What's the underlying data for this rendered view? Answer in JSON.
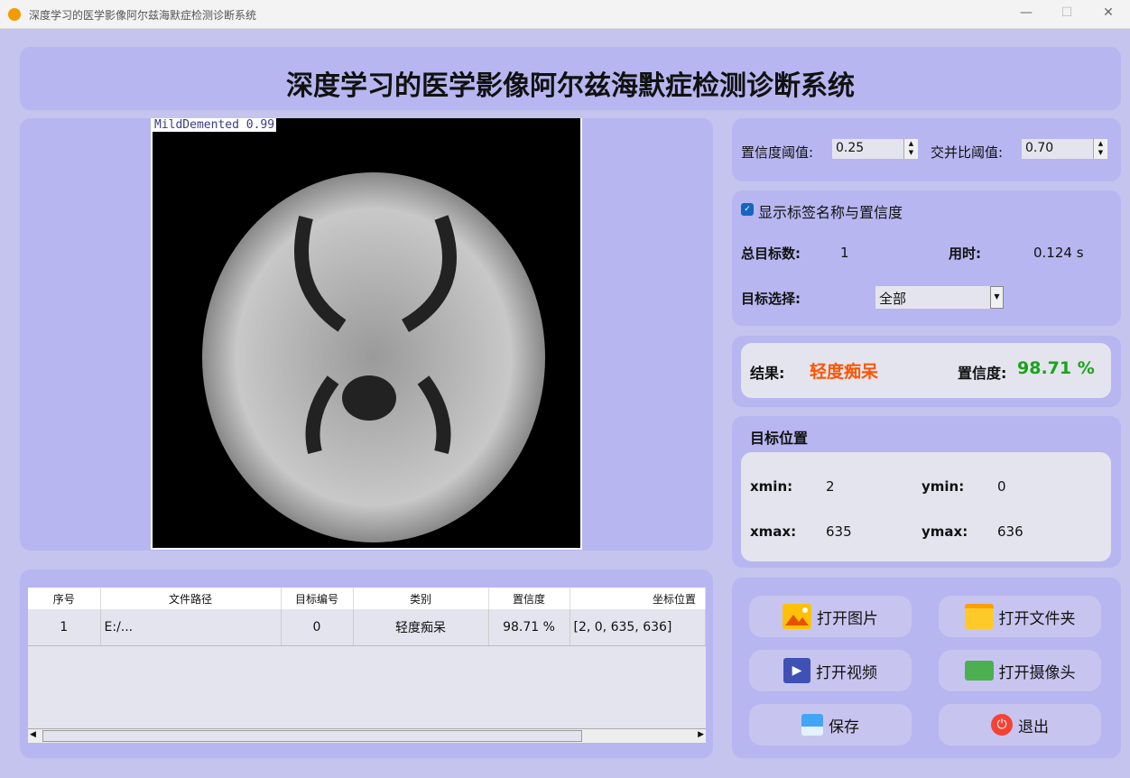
{
  "window": {
    "title": "深度学习的医学影像阿尔兹海默症检测诊断系统",
    "minimize": "—",
    "maximize": "☐",
    "close": "✕"
  },
  "header": {
    "title": "深度学习的医学影像阿尔兹海默症检测诊断系统"
  },
  "image": {
    "overlay_label": "MildDemented  0.99"
  },
  "settings": {
    "conf_label": "置信度阈值:",
    "conf_value": "0.25",
    "iou_label": "交并比阈值:",
    "iou_value": "0.70"
  },
  "stats": {
    "show_label": "显示标签名称与置信度",
    "show_checked": true,
    "total_label": "总目标数:",
    "total_value": "1",
    "time_label": "用时:",
    "time_value": "0.124 s",
    "select_label": "目标选择:",
    "select_value": "全部"
  },
  "result": {
    "label": "结果:",
    "value": "轻度痴呆",
    "conf_label": "置信度:",
    "conf_value": "98.71 %",
    "value_color": "#ff5500",
    "conf_color": "#1aa31a"
  },
  "position": {
    "title": "目标位置",
    "xmin_label": "xmin:",
    "xmin": "2",
    "ymin_label": "ymin:",
    "ymin": "0",
    "xmax_label": "xmax:",
    "xmax": "635",
    "ymax_label": "ymax:",
    "ymax": "636"
  },
  "table": {
    "columns": [
      "序号",
      "文件路径",
      "目标编号",
      "类别",
      "置信度",
      "坐标位置"
    ],
    "rows": [
      [
        "1",
        "E:/...",
        "0",
        "轻度痴呆",
        "98.71 %",
        "[2, 0, 635, 636]"
      ]
    ]
  },
  "buttons": {
    "open_image": "打开图片",
    "open_folder": "打开文件夹",
    "open_video": "打开视频",
    "open_camera": "打开摄像头",
    "save": "保存",
    "exit": "退出"
  }
}
